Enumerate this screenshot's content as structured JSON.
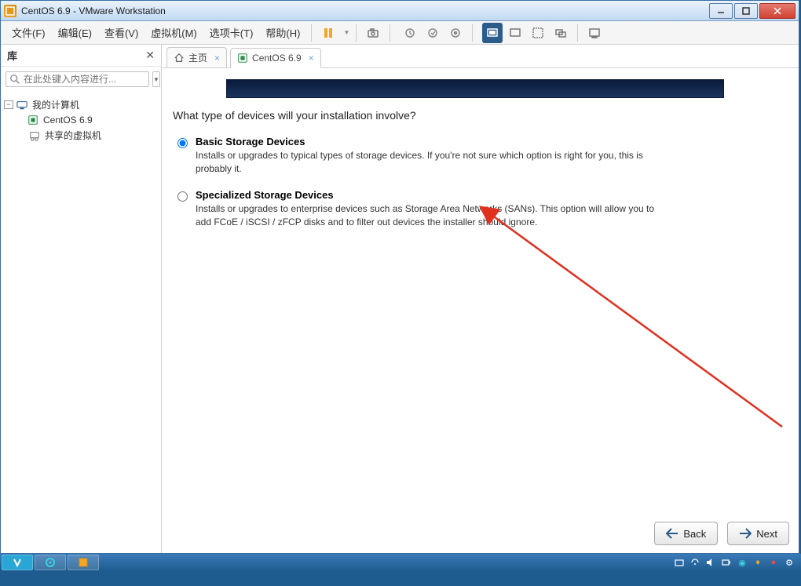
{
  "window": {
    "title": "CentOS 6.9 - VMware Workstation"
  },
  "menu": {
    "file": "文件(F)",
    "edit": "编辑(E)",
    "view": "查看(V)",
    "vm": "虚拟机(M)",
    "tabs": "选项卡(T)",
    "help": "帮助(H)"
  },
  "sidebar": {
    "title": "库",
    "search_placeholder": "在此处键入内容进行...",
    "tree": {
      "root": "我的计算机",
      "child": "CentOS 6.9",
      "shared": "共享的虚拟机"
    }
  },
  "tabs": {
    "home": "主页",
    "vm": "CentOS 6.9"
  },
  "installer": {
    "question": "What type of devices will your installation involve?",
    "opt1_title": "Basic Storage Devices",
    "opt1_desc": "Installs or upgrades to typical types of storage devices.  If you're not sure which option is right for you, this is probably it.",
    "opt2_title": "Specialized Storage Devices",
    "opt2_desc": "Installs or upgrades to enterprise devices such as Storage Area Networks (SANs). This option will allow you to add FCoE / iSCSI / zFCP disks and to filter out devices the installer should ignore."
  },
  "nav": {
    "back": "Back",
    "next": "Next"
  }
}
